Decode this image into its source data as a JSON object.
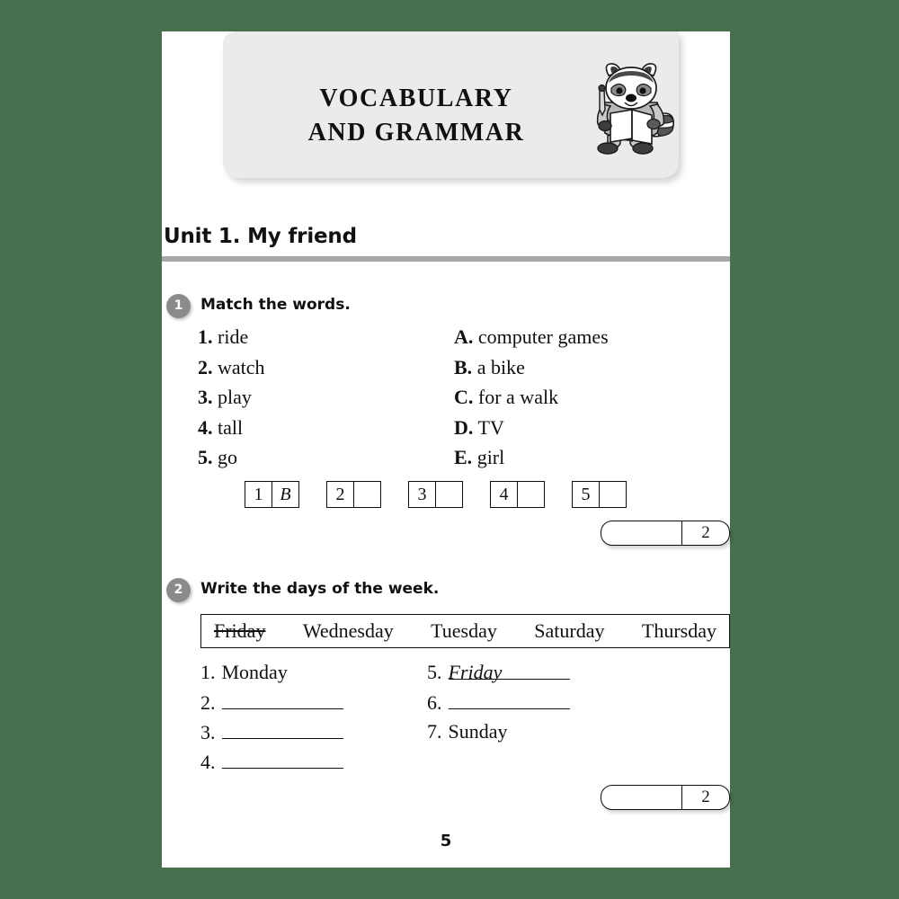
{
  "banner": {
    "title_line1": "VOCABULARY",
    "title_line2": "AND GRAMMAR",
    "mascot": "raccoon-with-book-icon"
  },
  "unit": {
    "title": "Unit 1. My friend"
  },
  "exercise1": {
    "number": "1",
    "instruction": "Match the words.",
    "left_column": [
      {
        "num": "1.",
        "word": "ride"
      },
      {
        "num": "2.",
        "word": "watch"
      },
      {
        "num": "3.",
        "word": "play"
      },
      {
        "num": "4.",
        "word": "tall"
      },
      {
        "num": "5.",
        "word": "go"
      }
    ],
    "right_column": [
      {
        "num": "A.",
        "word": "computer games"
      },
      {
        "num": "B.",
        "word": "a bike"
      },
      {
        "num": "C.",
        "word": "for a walk"
      },
      {
        "num": "D.",
        "word": "TV"
      },
      {
        "num": "E.",
        "word": "girl"
      }
    ],
    "answer_boxes": [
      {
        "label": "1",
        "answer": "B"
      },
      {
        "label": "2",
        "answer": ""
      },
      {
        "label": "3",
        "answer": ""
      },
      {
        "label": "4",
        "answer": ""
      },
      {
        "label": "5",
        "answer": ""
      }
    ],
    "score": {
      "blank": "",
      "value": "2"
    }
  },
  "exercise2": {
    "number": "2",
    "instruction": "Write the days of the week.",
    "word_bank": [
      {
        "word": "Friday",
        "used": true
      },
      {
        "word": "Wednesday",
        "used": false
      },
      {
        "word": "Tuesday",
        "used": false
      },
      {
        "word": "Saturday",
        "used": false
      },
      {
        "word": "Thursday",
        "used": false
      }
    ],
    "answers_left": [
      {
        "num": "1.",
        "value": "Monday",
        "line": false
      },
      {
        "num": "2.",
        "value": "",
        "line": true
      },
      {
        "num": "3.",
        "value": "",
        "line": true
      },
      {
        "num": "4.",
        "value": "",
        "line": true
      }
    ],
    "answers_right": [
      {
        "num": "5.",
        "value": "Friday",
        "line": true
      },
      {
        "num": "6.",
        "value": "",
        "line": true
      },
      {
        "num": "7.",
        "value": "Sunday",
        "line": false
      }
    ],
    "score": {
      "blank": "",
      "value": "2"
    }
  },
  "page_number": "5",
  "colors": {
    "background": "#48704e",
    "banner": "#ebebeb",
    "rule": "#a8a8a8",
    "badge": "#8b8b8b"
  }
}
